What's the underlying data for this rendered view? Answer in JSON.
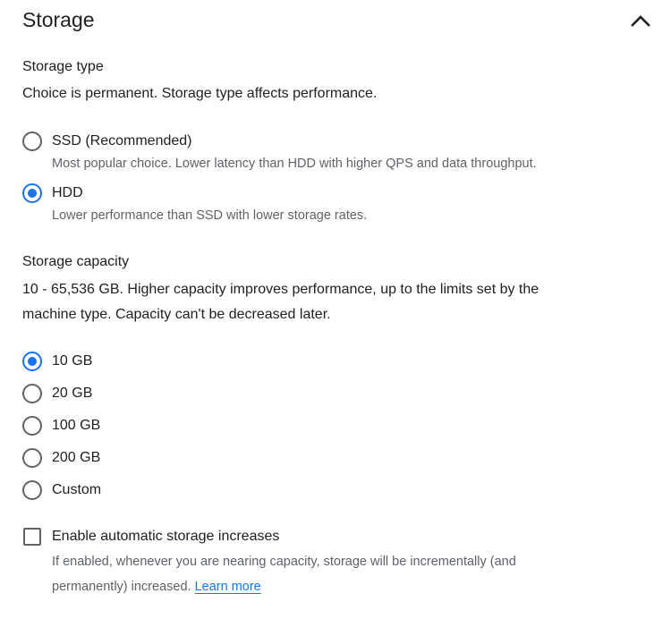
{
  "section": {
    "title": "Storage"
  },
  "storage_type": {
    "heading": "Storage type",
    "description": "Choice is permanent. Storage type affects performance.",
    "options": [
      {
        "label": "SSD (Recommended)",
        "help": "Most popular choice. Lower latency than HDD with higher QPS and data throughput.",
        "selected": false
      },
      {
        "label": "HDD",
        "help": "Lower performance than SSD with lower storage rates.",
        "selected": true
      }
    ]
  },
  "storage_capacity": {
    "heading": "Storage capacity",
    "description_line1": "10 - 65,536 GB. Higher capacity improves performance, up to the limits set by the",
    "description_line2": "machine type. Capacity can't be decreased later.",
    "options": [
      {
        "label": "10 GB",
        "selected": true
      },
      {
        "label": "20 GB",
        "selected": false
      },
      {
        "label": "100 GB",
        "selected": false
      },
      {
        "label": "200 GB",
        "selected": false
      },
      {
        "label": "Custom",
        "selected": false
      }
    ]
  },
  "auto_increase": {
    "label": "Enable automatic storage increases",
    "checked": false,
    "help_line1": "If enabled, whenever you are nearing capacity, storage will be incrementally (and",
    "help_line2": "permanently) increased.",
    "link_text": "Learn more"
  },
  "colors": {
    "accent": "#1a73e8",
    "text": "#202124",
    "secondary_text": "#5f6368"
  },
  "icons": {
    "collapse": "chevron-up-icon"
  }
}
